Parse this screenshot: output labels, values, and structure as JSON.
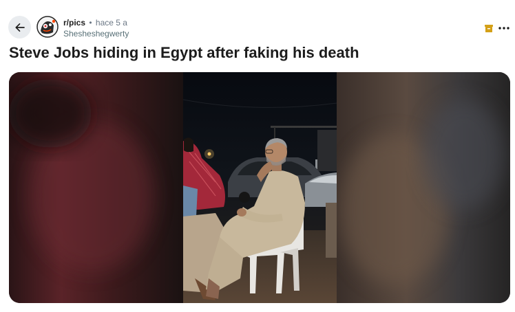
{
  "post": {
    "subreddit": "r/pics",
    "separator": "•",
    "time": "hace 5 a",
    "author": "Shesheshegwerty",
    "title": "Steve Jobs hiding in Egypt after faking his death"
  },
  "icons": {
    "back": "arrow-left-icon",
    "community_avatar": "subreddit-avatar",
    "award": "gift-box-icon",
    "more": "ellipsis-icon"
  },
  "colors": {
    "award": "#d4a017",
    "button_bg": "#e9ecef",
    "meta_text": "#6b7785"
  }
}
